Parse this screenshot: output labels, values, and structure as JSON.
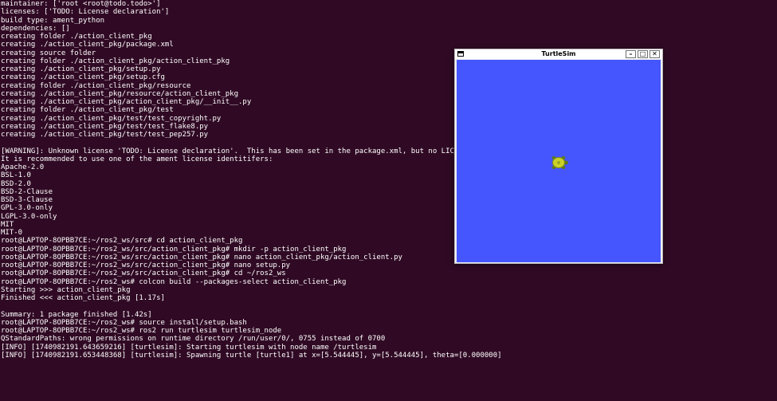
{
  "terminal": {
    "lines": [
      "maintainer: ['root <root@todo.todo>']",
      "licenses: ['TODO: License declaration']",
      "build type: ament_python",
      "dependencies: []",
      "creating folder ./action_client_pkg",
      "creating ./action_client_pkg/package.xml",
      "creating source folder",
      "creating folder ./action_client_pkg/action_client_pkg",
      "creating ./action_client_pkg/setup.py",
      "creating ./action_client_pkg/setup.cfg",
      "creating folder ./action_client_pkg/resource",
      "creating ./action_client_pkg/resource/action_client_pkg",
      "creating ./action_client_pkg/action_client_pkg/__init__.py",
      "creating folder ./action_client_pkg/test",
      "creating ./action_client_pkg/test/test_copyright.py",
      "creating ./action_client_pkg/test/test_flake8.py",
      "creating ./action_client_pkg/test/test_pep257.py",
      "",
      "[WARNING]: Unknown license 'TODO: License declaration'.  This has been set in the package.xml, but no LICENSE f",
      "It is recommended to use one of the ament license identitifers:",
      "Apache-2.0",
      "BSL-1.0",
      "BSD-2.0",
      "BSD-2-Clause",
      "BSD-3-Clause",
      "GPL-3.0-only",
      "LGPL-3.0-only",
      "MIT",
      "MIT-0",
      "root@LAPTOP-8OPBB7CE:~/ros2_ws/src# cd action_client_pkg",
      "root@LAPTOP-8OPBB7CE:~/ros2_ws/src/action_client_pkg# mkdir -p action_client_pkg",
      "root@LAPTOP-8OPBB7CE:~/ros2_ws/src/action_client_pkg# nano action_client_pkg/action_client.py",
      "root@LAPTOP-8OPBB7CE:~/ros2_ws/src/action_client_pkg# nano setup.py",
      "root@LAPTOP-8OPBB7CE:~/ros2_ws/src/action_client_pkg# cd ~/ros2_ws",
      "root@LAPTOP-8OPBB7CE:~/ros2_ws# colcon build --packages-select action_client_pkg",
      "Starting >>> action_client_pkg",
      "Finished <<< action_client_pkg [1.17s]",
      "",
      "Summary: 1 package finished [1.42s]",
      "root@LAPTOP-8OPBB7CE:~/ros2_ws# source install/setup.bash",
      "root@LAPTOP-8OPBB7CE:~/ros2_ws# ros2 run turtlesim turtlesim_node",
      "QStandardPaths: wrong permissions on runtime directory /run/user/0/, 0755 instead of 0700",
      "[INFO] [1740982191.643659216] [turtlesim]: Starting turtlesim with node name /turtlesim",
      "[INFO] [1740982191.653448368] [turtlesim]: Spawning turtle [turtle1] at x=[5.544445], y=[5.544445], theta=[0.000000]"
    ]
  },
  "window": {
    "title": "TurtleSim",
    "minimize_label": "–",
    "maximize_label": "□",
    "close_label": "✕"
  },
  "colors": {
    "terminal_bg": "#300a24",
    "canvas_bg": "#4556ff",
    "turtle_shell": "#c9d12a",
    "turtle_body": "#5d7a1e"
  },
  "icons": {
    "app": "window-icon",
    "turtle": "turtle-icon"
  }
}
